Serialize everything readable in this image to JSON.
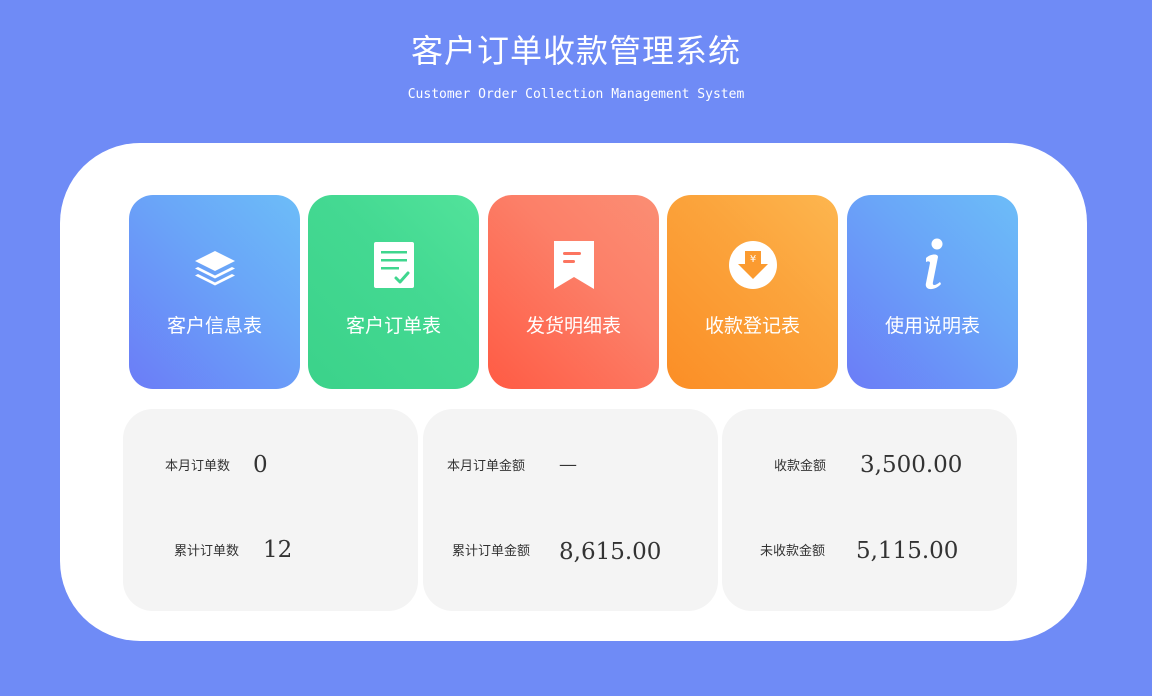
{
  "header": {
    "title": "客户订单收款管理系统",
    "subtitle": "Customer Order Collection Management System"
  },
  "tiles": [
    {
      "label": "客户信息表",
      "icon": "layers-icon",
      "color_from": "#6b7cf7",
      "color_to": "#6cbdf8"
    },
    {
      "label": "客户订单表",
      "icon": "checklist-document-icon",
      "color_from": "#3bd28a",
      "color_to": "#52e39b"
    },
    {
      "label": "发货明细表",
      "icon": "bookmark-icon",
      "color_from": "#ff5b44",
      "color_to": "#fb8e74"
    },
    {
      "label": "收款登记表",
      "icon": "yen-download-icon",
      "color_from": "#fb8e26",
      "color_to": "#fdb64f"
    },
    {
      "label": "使用说明表",
      "icon": "info-icon",
      "color_from": "#6b7cf7",
      "color_to": "#6cbdf8"
    }
  ],
  "stats": {
    "month_order_count": {
      "label": "本月订单数",
      "value": "0"
    },
    "total_order_count": {
      "label": "累计订单数",
      "value": "12"
    },
    "month_order_amount": {
      "label": "本月订单金额",
      "value": "—"
    },
    "total_order_amount": {
      "label": "累计订单金额",
      "value": "8,615.00"
    },
    "received_amount": {
      "label": "收款金额",
      "value": "3,500.00"
    },
    "unreceived_amount": {
      "label": "未收款金额",
      "value": "5,115.00"
    }
  },
  "colors": {
    "background": "#6f8bf6",
    "panel": "#ffffff",
    "stat_card": "#f4f4f4"
  }
}
